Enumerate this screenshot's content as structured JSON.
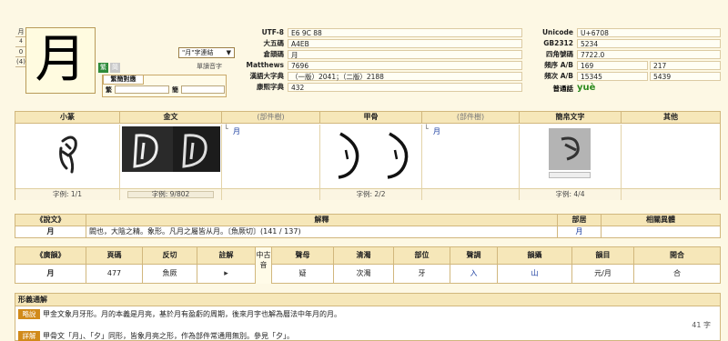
{
  "header": {
    "character": "月",
    "strokes_top": "4",
    "mini_char": "月",
    "radical_strokes": "0",
    "total_strokes": "(4)",
    "icon_trad": "繁",
    "icon_simp": "简",
    "related_select": "\"月\"字連結",
    "pronounce_link": "單讀音字",
    "trad_simp_tab": "繁簡對應",
    "trad_label": "繁",
    "simp_label": "簡"
  },
  "codes_left": [
    {
      "label": "UTF-8",
      "value": "E6 9C 88"
    },
    {
      "label": "大五碼",
      "value": "A4EB"
    },
    {
      "label": "倉頡碼",
      "value": "月"
    },
    {
      "label": "Matthews",
      "value": "7696"
    },
    {
      "label": "漢語大字典",
      "value": "（一版）2041；（二版）2188"
    },
    {
      "label": "康熙字典",
      "value": "432"
    }
  ],
  "codes_right": [
    {
      "label": "Unicode",
      "value": "U+6708",
      "value2": ""
    },
    {
      "label": "GB2312",
      "value": "5234",
      "value2": ""
    },
    {
      "label": "四角號碼",
      "value": "7722.0",
      "value2": ""
    },
    {
      "label": "頻序 A/B",
      "value": "169",
      "value2": "217"
    },
    {
      "label": "頻次 A/B",
      "value": "15345",
      "value2": "5439"
    }
  ],
  "putonghua": {
    "label": "普通話",
    "value": "yuè"
  },
  "forms": {
    "headers": [
      "小篆",
      "金文",
      "(部件樹)",
      "甲骨",
      "(部件樹)",
      "簡帛文字",
      "其他"
    ],
    "tree_tag": "月",
    "footers": [
      "字例: 1/1",
      "字例: 9/802",
      "字例: 2/2",
      "字例: 4/4"
    ]
  },
  "shuowen": {
    "headers": [
      "《說文》",
      "解釋",
      "部居",
      "相關異體"
    ],
    "label": "月",
    "text": "闕也，大陰之精。象形。凡月之屬皆从月。〔魚厥切〕(141 / 137)",
    "radical": "月"
  },
  "guangyun": {
    "headers": [
      "《廣韻》",
      "頁碼",
      "反切",
      "註解",
      "聲母",
      "清濁",
      "部位",
      "聲調",
      "韻攝",
      "韻目",
      "開合",
      "等第"
    ],
    "zhonggu": "中古音",
    "row": [
      "月",
      "477",
      "魚厥",
      "",
      "疑",
      "次濁",
      "牙",
      "入",
      "山",
      "元/月",
      "合",
      "三"
    ]
  },
  "etymology": {
    "title": "形義通解",
    "tag1": "略說",
    "text1": "甲金文象月牙形。月的本義是月亮，基於月有盈虧的周期，後來月字也解為曆法中年月的月。",
    "count": "41 字",
    "tag2": "詳解",
    "text2": "甲骨文「月」、「夕」同形，皆象月亮之形，作為部件常通用無別。參見「夕」。"
  }
}
